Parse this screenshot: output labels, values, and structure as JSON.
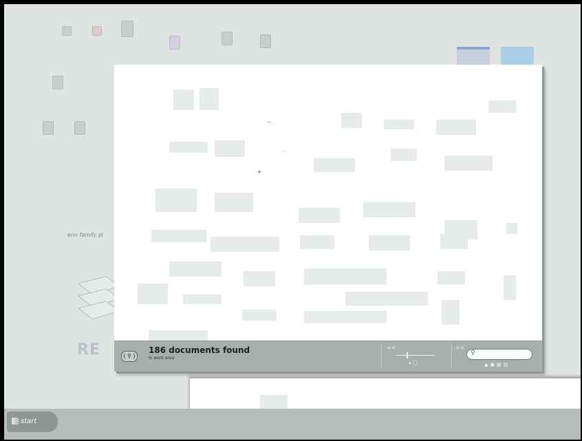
{
  "statusbar": {
    "count_text": "186 documents found",
    "count_sub": "in work area",
    "search_placeholder": "",
    "collapse_glyph_1": "<<",
    "collapse_glyph_2": "<<"
  },
  "desktop": {
    "family_label": "enn family pi",
    "brand_text": "RE"
  },
  "taskbar": {
    "start_label": "start"
  },
  "colors": {
    "desktop_bg": "#dfe3e2",
    "statusbar_bg": "#a7aeac",
    "taskbar_bg": "#b7bdbb",
    "window_bg": "#ffffff"
  },
  "icons": [
    "search-icon",
    "magnifier-icon",
    "zoom-out-icon",
    "zoom-in-icon",
    "view-mode-icons",
    "windows-flag-icon"
  ]
}
